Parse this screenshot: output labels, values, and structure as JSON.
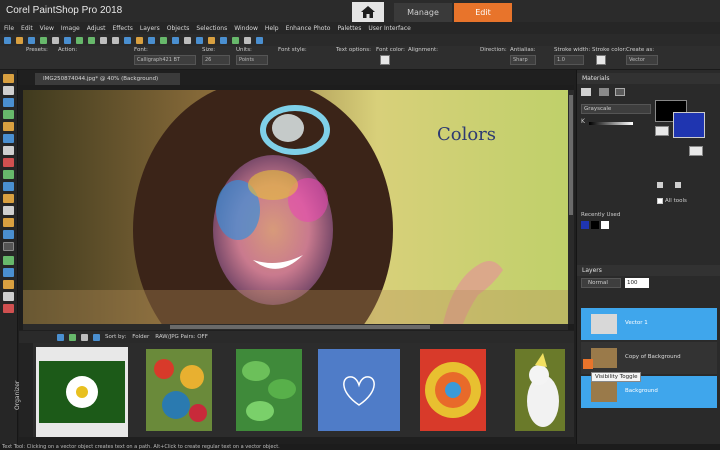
{
  "app": {
    "title": "Corel PaintShop Pro 2018",
    "tabs": {
      "manage": "Manage",
      "edit": "Edit"
    }
  },
  "menu": [
    "File",
    "Edit",
    "View",
    "Image",
    "Adjust",
    "Effects",
    "Layers",
    "Objects",
    "Selections",
    "Window",
    "Help",
    "Enhance Photo",
    "Palettes",
    "User Interface"
  ],
  "options": {
    "presets": "Presets:",
    "action": "Action:",
    "font": "Font:",
    "font_value": "Calligraph421 BT",
    "size": "Size:",
    "size_value": "26",
    "units": "Units:",
    "units_value": "Points",
    "font_style": "Font style:",
    "text_options": "Text options:",
    "font_color": "Font color:",
    "alignment": "Alignment:",
    "direction": "Direction:",
    "antialias": "Antialias:",
    "antialias_value": "Sharp",
    "stroke_width": "Stroke width:",
    "stroke_width_value": "1.0",
    "stroke_color": "Stroke color:",
    "create_as": "Create as:",
    "create_as_value": "Vector"
  },
  "document": {
    "tab": "IMG250874044.jpg* @ 40% (Background)",
    "canvas_text": "Colors"
  },
  "organizer": {
    "sort_by": "Sort by:",
    "sort_value": "Folder",
    "raw_pairs": "RAW/JPG Pairs: OFF",
    "side_label": "Organizer"
  },
  "materials": {
    "title": "Materials",
    "mode": "Grayscale",
    "k_label": "K",
    "all_tools": "All tools",
    "recently_used": "Recently Used"
  },
  "layers": {
    "title": "Layers",
    "blend_mode": "Normal",
    "opacity": "100",
    "items": [
      {
        "name": "Vector 1"
      },
      {
        "name": "Copy of Background"
      },
      {
        "name": "Background"
      }
    ],
    "tooltip": "Visibility Toggle"
  },
  "status": "Text Tool: Clicking on a vector object creates text on a path. Alt+Click to create regular text on a vector object.",
  "colors": {
    "accent": "#e8742b",
    "layer_selected": "#3fa6ec"
  }
}
